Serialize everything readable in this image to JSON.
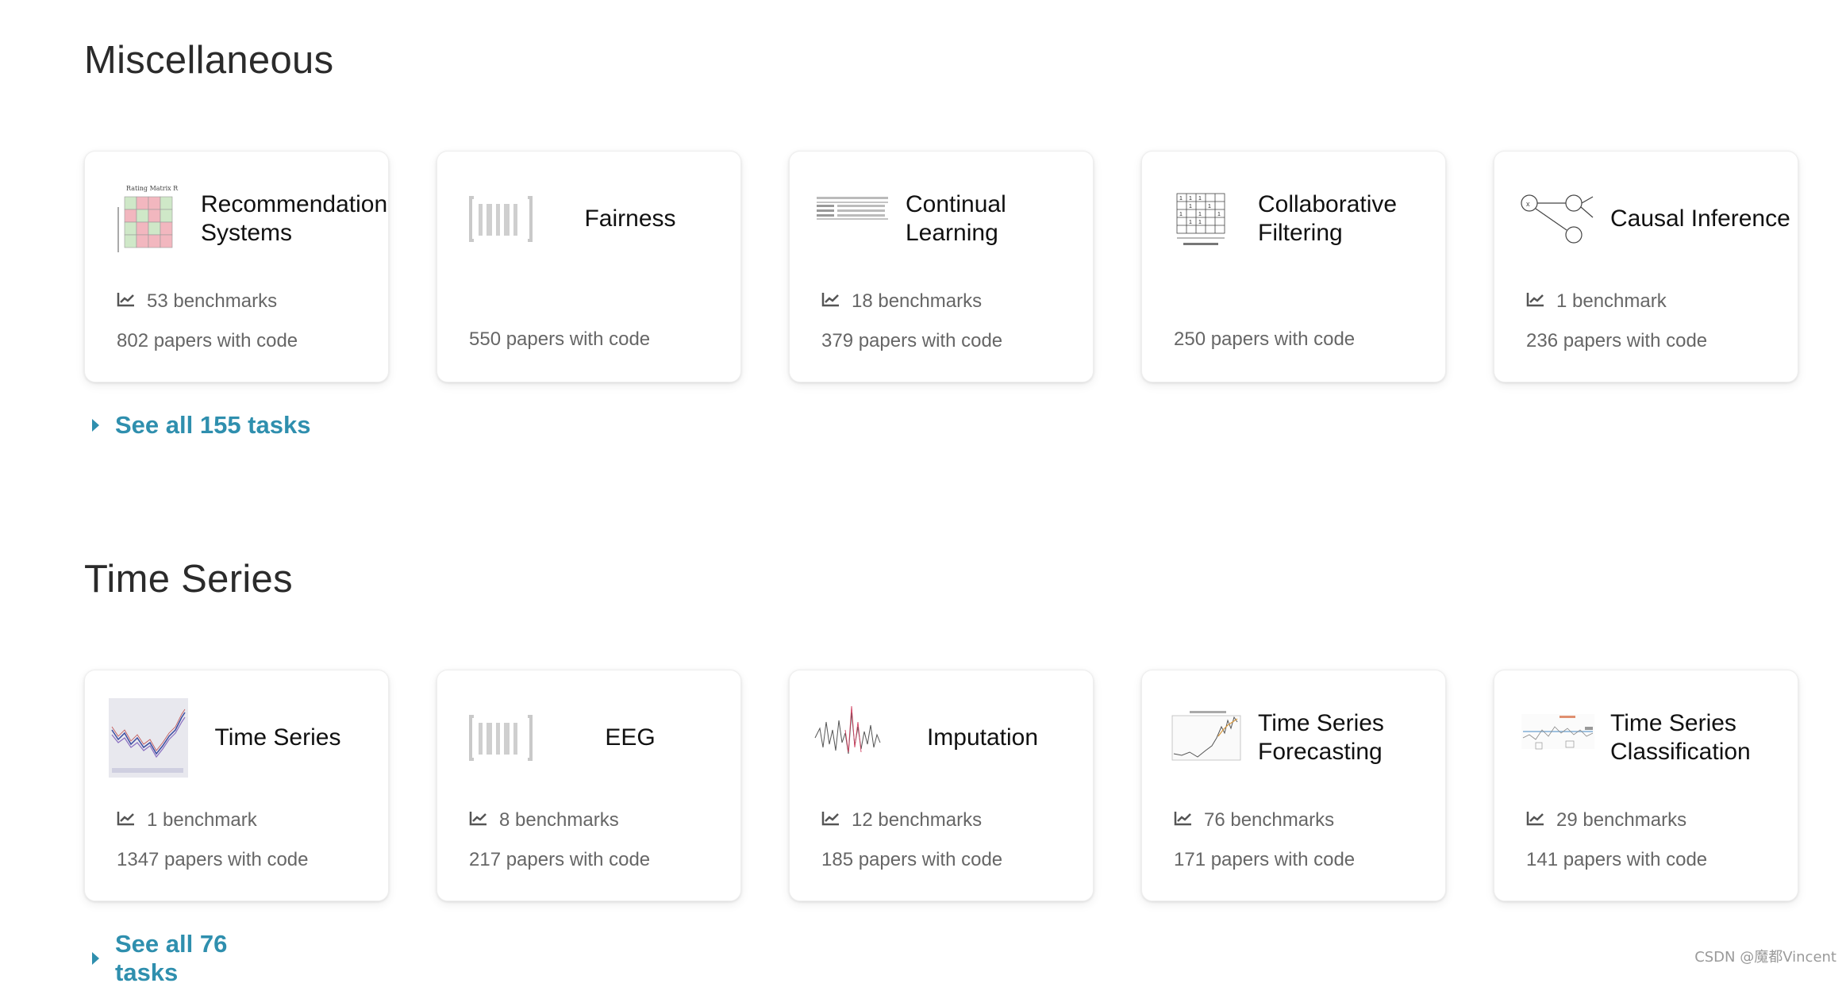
{
  "sections": [
    {
      "title": "Miscellaneous",
      "see_all": "See all 155 tasks",
      "cards": [
        {
          "name": "Recommendation Systems",
          "benchmarks": "53 benchmarks",
          "papers": "802 papers with code",
          "icon": "rating-matrix-thumbnail"
        },
        {
          "name": "Fairness",
          "benchmarks": "",
          "papers": "550 papers with code",
          "icon": "barcode-placeholder-icon"
        },
        {
          "name": "Continual Learning",
          "benchmarks": "18 benchmarks",
          "papers": "379 papers with code",
          "icon": "table-thumbnail"
        },
        {
          "name": "Collaborative Filtering",
          "benchmarks": "",
          "papers": "250 papers with code",
          "icon": "user-item-matrix-thumbnail"
        },
        {
          "name": "Causal Inference",
          "benchmarks": "1 benchmark",
          "papers": "236 papers with code",
          "icon": "causal-graph-thumbnail"
        }
      ]
    },
    {
      "title": "Time Series",
      "see_all": "See all 76 tasks",
      "cards": [
        {
          "name": "Time Series",
          "benchmarks": "1 benchmark",
          "papers": "1347 papers with code",
          "icon": "time-series-plot-thumbnail"
        },
        {
          "name": "EEG",
          "benchmarks": "8 benchmarks",
          "papers": "217 papers with code",
          "icon": "barcode-placeholder-icon"
        },
        {
          "name": "Imputation",
          "benchmarks": "12 benchmarks",
          "papers": "185 papers with code",
          "icon": "signal-plot-thumbnail"
        },
        {
          "name": "Time Series Forecasting",
          "benchmarks": "76 benchmarks",
          "papers": "171 papers with code",
          "icon": "forecast-plot-thumbnail"
        },
        {
          "name": "Time Series Classification",
          "benchmarks": "29 benchmarks",
          "papers": "141 papers with code",
          "icon": "classification-plot-thumbnail"
        }
      ]
    }
  ],
  "watermark": "CSDN @魔都Vincent",
  "colors": {
    "link": "#2f8fae",
    "muted_text": "#666666"
  }
}
